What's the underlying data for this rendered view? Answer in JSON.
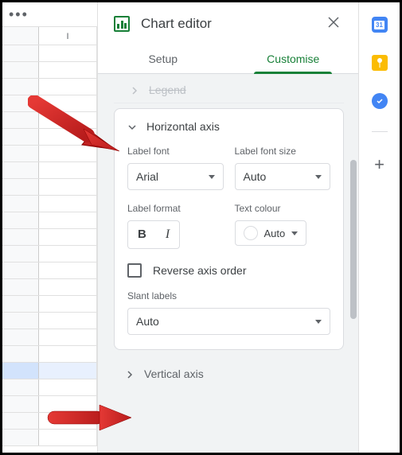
{
  "header": {
    "title": "Chart editor"
  },
  "tabs": {
    "setup": "Setup",
    "customise": "Customise"
  },
  "truncated_section": {
    "label": "Legend"
  },
  "horizontal_axis": {
    "title": "Horizontal axis",
    "label_font": {
      "label": "Label font",
      "value": "Arial"
    },
    "label_font_size": {
      "label": "Label font size",
      "value": "Auto"
    },
    "label_format": {
      "label": "Label format"
    },
    "text_colour": {
      "label": "Text colour",
      "value": "Auto"
    },
    "reverse_axis": "Reverse axis order",
    "slant_labels": {
      "label": "Slant labels",
      "value": "Auto"
    }
  },
  "vertical_axis": {
    "title": "Vertical axis"
  },
  "sheet": {
    "col": "I"
  },
  "side_icons": {
    "calendar": "31"
  }
}
